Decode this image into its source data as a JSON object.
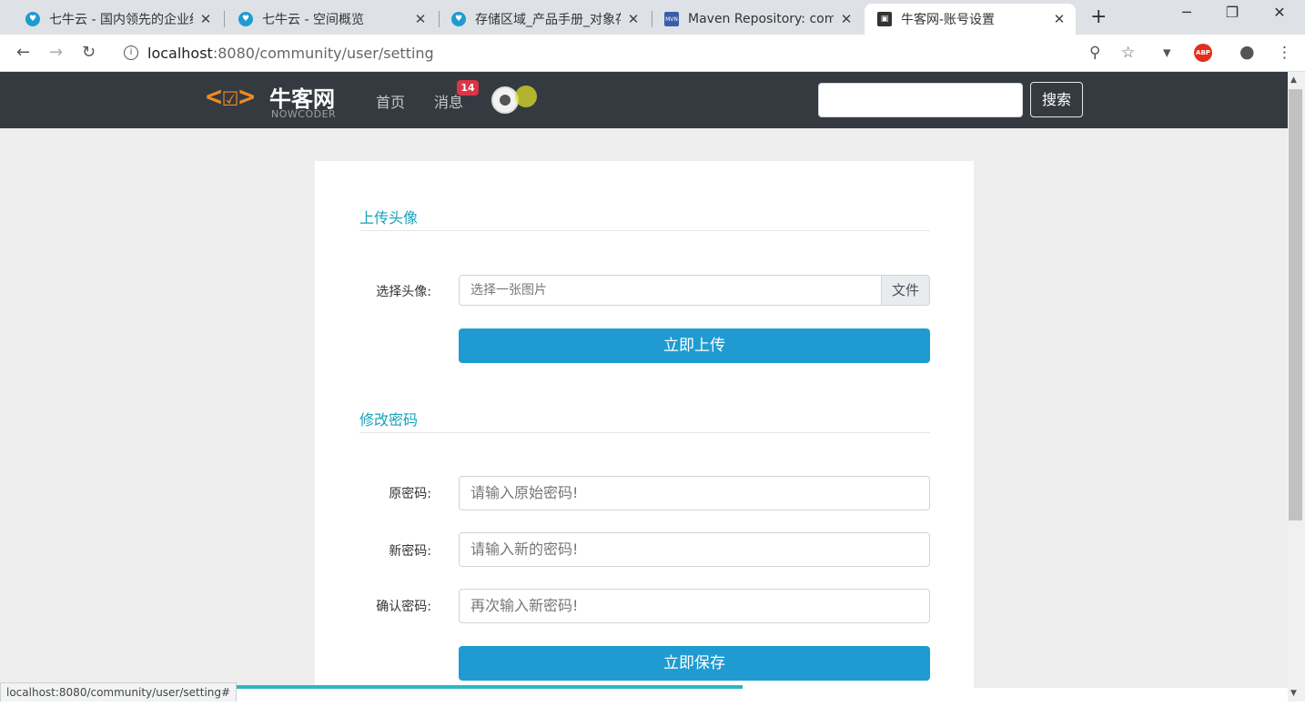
{
  "browser": {
    "tabs": [
      {
        "title": "七牛云 - 国内领先的企业级",
        "favicon_color": "#1f9bd1"
      },
      {
        "title": "七牛云 - 空间概览",
        "favicon_color": "#1f9bd1"
      },
      {
        "title": "存储区域_产品手册_对象存",
        "favicon_color": "#1f9bd1"
      },
      {
        "title": "Maven Repository: com.c",
        "favicon_color": "#3a5ea8"
      },
      {
        "title": "牛客网-账号设置",
        "favicon_color": "#333333"
      }
    ],
    "close_glyph": "✕",
    "new_tab": "+",
    "window_controls": {
      "minimize": "─",
      "maximize": "❐",
      "close": "✕"
    },
    "url_host": "localhost",
    "url_path": ":8080/community/user/setting",
    "abp_label": "ABP"
  },
  "site": {
    "brand": "牛客网",
    "brand_sub": "NOWCODER",
    "nav_home": "首页",
    "nav_messages": "消息",
    "message_count": "14",
    "search_button": "搜索"
  },
  "settings": {
    "upload_section_title": "上传头像",
    "choose_avatar_label": "选择头像:",
    "file_placeholder": "选择一张图片",
    "file_button": "文件",
    "upload_button": "立即上传",
    "password_section_title": "修改密码",
    "old_password_label": "原密码:",
    "old_password_placeholder": "请输入原始密码!",
    "new_password_label": "新密码:",
    "new_password_placeholder": "请输入新的密码!",
    "confirm_password_label": "确认密码:",
    "confirm_password_placeholder": "再次输入新密码!",
    "save_button": "立即保存"
  },
  "status": {
    "url": "localhost:8080/community/user/setting#"
  },
  "colors": {
    "accent": "#17a2b8",
    "primary_button": "#1f9bd1",
    "header_bg": "#343a40",
    "badge": "#dc3545"
  }
}
